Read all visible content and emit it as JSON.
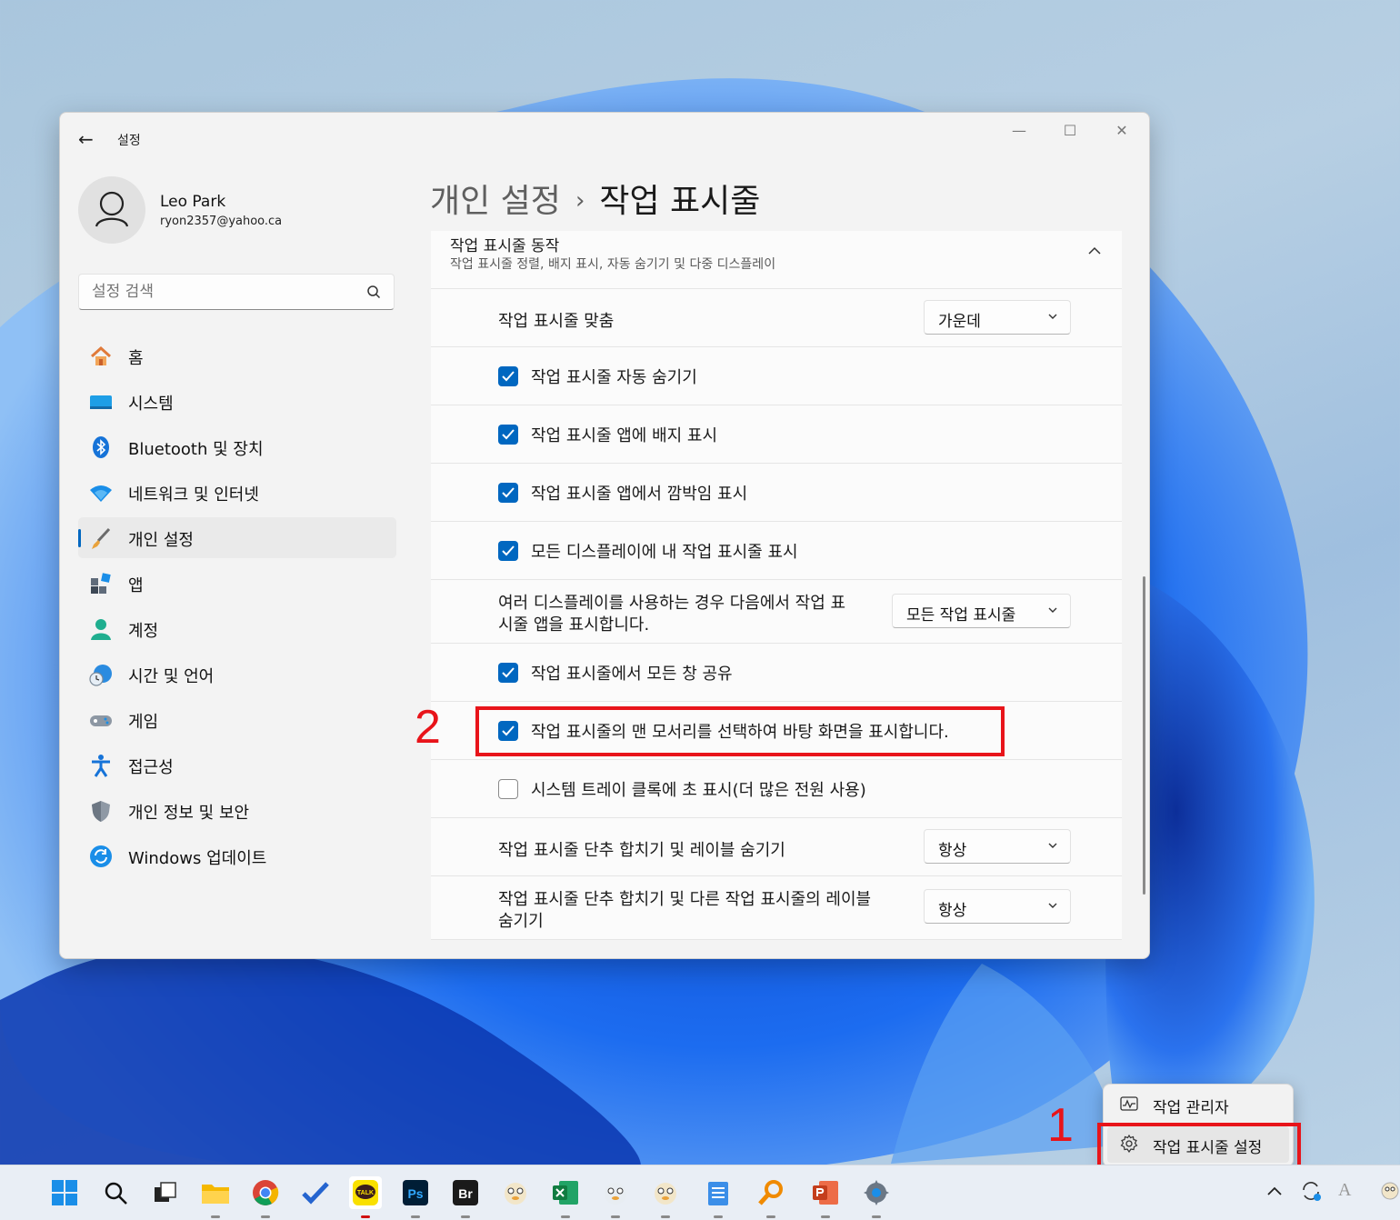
{
  "window": {
    "app_title": "설정",
    "minimize": "—",
    "maximize": "☐",
    "close": "✕"
  },
  "profile": {
    "name": "Leo Park",
    "email": "ryon2357@yahoo.ca"
  },
  "search": {
    "placeholder": "설정 검색"
  },
  "nav": [
    {
      "label": "홈",
      "icon": "home-icon"
    },
    {
      "label": "시스템",
      "icon": "system-icon"
    },
    {
      "label": "Bluetooth 및 장치",
      "icon": "bluetooth-icon"
    },
    {
      "label": "네트워크 및 인터넷",
      "icon": "wifi-icon"
    },
    {
      "label": "개인 설정",
      "icon": "brush-icon",
      "active": true
    },
    {
      "label": "앱",
      "icon": "apps-icon"
    },
    {
      "label": "계정",
      "icon": "account-icon"
    },
    {
      "label": "시간 및 언어",
      "icon": "time-language-icon"
    },
    {
      "label": "게임",
      "icon": "gaming-icon"
    },
    {
      "label": "접근성",
      "icon": "accessibility-icon"
    },
    {
      "label": "개인 정보 및 보안",
      "icon": "shield-icon"
    },
    {
      "label": "Windows 업데이트",
      "icon": "update-icon"
    }
  ],
  "breadcrumb": {
    "parent": "개인 설정",
    "separator": "›",
    "current": "작업 표시줄"
  },
  "section": {
    "title": "작업 표시줄 동작",
    "subtitle": "작업 표시줄 정렬, 배지 표시, 자동 숨기기 및 다중 디스플레이"
  },
  "settings": {
    "alignment": {
      "label": "작업 표시줄 맞춤",
      "value": "가운데"
    },
    "auto_hide": {
      "label": "작업 표시줄 자동 숨기기",
      "checked": true
    },
    "badges": {
      "label": "작업 표시줄 앱에 배지 표시",
      "checked": true
    },
    "flashing": {
      "label": "작업 표시줄 앱에서 깜박임 표시",
      "checked": true
    },
    "all_displays": {
      "label": "모든 디스플레이에 내 작업 표시줄 표시",
      "checked": true
    },
    "multi_display": {
      "label_line1": "여러 디스플레이를 사용하는 경우 다음에서 작업 표",
      "label_line2": "시줄 앱을 표시합니다.",
      "value": "모든 작업 표시줄"
    },
    "share_window": {
      "label": "작업 표시줄에서 모든 창 공유",
      "checked": true
    },
    "far_corner": {
      "label": "작업 표시줄의 맨 모서리를 선택하여 바탕 화면을 표시합니다.",
      "checked": true
    },
    "seconds": {
      "label": "시스템 트레이 클록에 초 표시(더 많은 전원 사용)",
      "checked": false
    },
    "combine_buttons": {
      "label": "작업 표시줄 단추 합치기 및 레이블 숨기기",
      "value": "항상"
    },
    "combine_other": {
      "label_line1": "작업 표시줄 단추 합치기 및 다른 작업 표시줄의 레이블",
      "label_line2": "숨기기",
      "value": "항상"
    }
  },
  "annotations": {
    "step1": "1",
    "step2": "2",
    "color": "#e8141a"
  },
  "context_menu": {
    "task_manager": "작업 관리자",
    "taskbar_settings": "작업 표시줄 설정"
  },
  "taskbar": {
    "apps": [
      "start-icon",
      "search-icon",
      "task-view-icon",
      "file-explorer-icon",
      "chrome-icon",
      "todo-icon",
      "kakaotalk-icon",
      "photoshop-icon",
      "bridge-icon",
      "app-icon",
      "excel-icon",
      "app-icon",
      "app-icon",
      "notepad-icon",
      "search-app-icon",
      "powerpoint-icon",
      "settings-icon"
    ],
    "kakao_label": "TALK",
    "ps_label": "Ps",
    "br_label": "Br",
    "tray_chevron": "^",
    "tray_font": "A"
  },
  "colors": {
    "accent": "#0067c0",
    "window_bg": "#f3f3f3",
    "card_bg": "#fbfbfb"
  }
}
